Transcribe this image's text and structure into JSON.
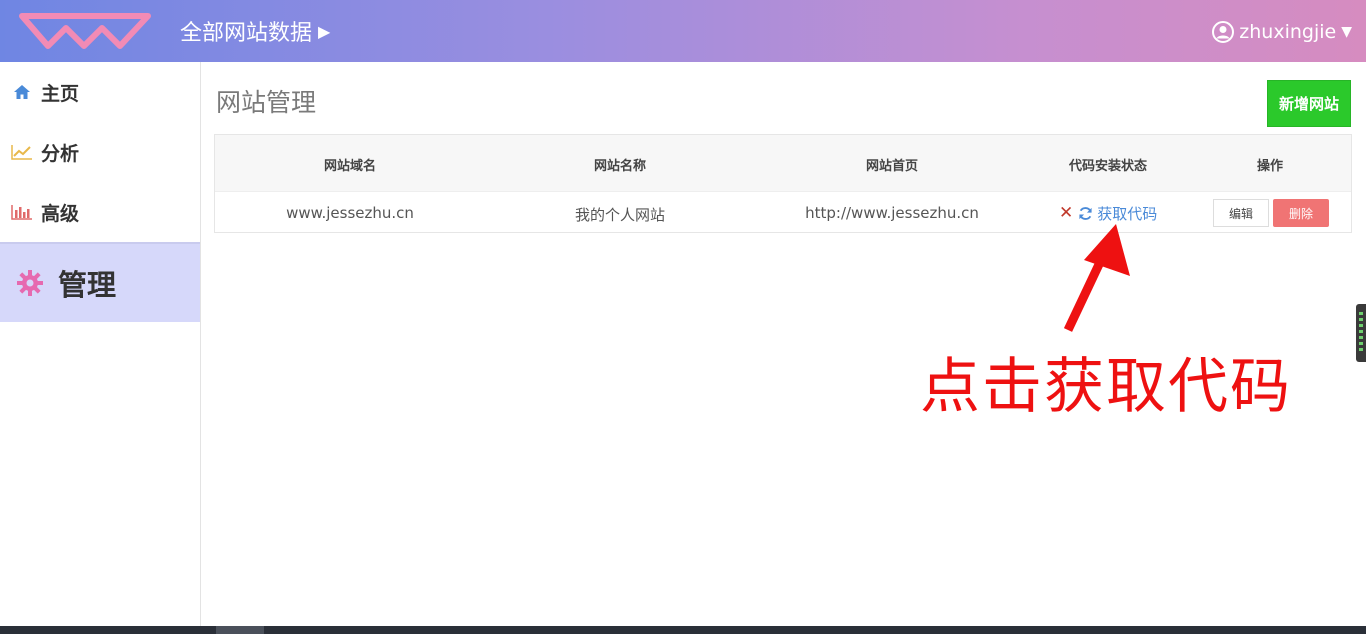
{
  "header": {
    "site_selector": "全部网站数据",
    "username": "zhuxingjie"
  },
  "sidebar": {
    "items": [
      {
        "label": "主页",
        "icon": "home-icon",
        "color": "#4a8ad8"
      },
      {
        "label": "分析",
        "icon": "line-chart-icon",
        "color": "#e8b84a"
      },
      {
        "label": "高级",
        "icon": "bar-chart-icon",
        "color": "#e06a6a"
      },
      {
        "label": "管理",
        "icon": "gear-icon",
        "color": "#e66ab0",
        "active": true
      }
    ]
  },
  "main": {
    "title": "网站管理",
    "add_button": "新增网站",
    "table": {
      "headers": [
        "网站域名",
        "网站名称",
        "网站首页",
        "代码安装状态",
        "操作"
      ],
      "rows": [
        {
          "domain": "www.jessezhu.cn",
          "name": "我的个人网站",
          "homepage": "http://www.jessezhu.cn",
          "status_mark": "✕",
          "get_code": "获取代码",
          "edit": "编辑",
          "delete": "删除"
        }
      ]
    }
  },
  "annotation": {
    "text": "点击获取代码",
    "color": "#ee1111"
  },
  "colors": {
    "accent_green": "#2bc92b",
    "delete_red": "#f07474",
    "link_blue": "#4a8ad8",
    "active_nav_bg": "#d6d8fa"
  }
}
